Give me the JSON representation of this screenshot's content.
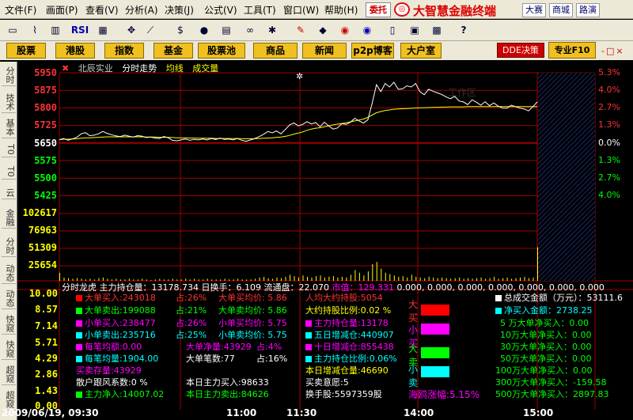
{
  "menu": [
    "文件(F)",
    "画面(P)",
    "查看(V)",
    "分析(A)",
    "决策(J)",
    "公式(V)",
    "工具(T)",
    "窗口(W)",
    "帮助(H)"
  ],
  "entrust_label": "委托",
  "brand_title": "大智慧金融终端",
  "sites": [
    "大赛",
    "商城",
    "路演"
  ],
  "nav_buttons": [
    "股票",
    "港股",
    "指数",
    "基金",
    "股票池",
    "商品",
    "新闻",
    "p2p博客",
    "大户室"
  ],
  "workarea_label": "工作区",
  "dde_label": "DDE决策",
  "pro_label": "专业F10",
  "side_tabs": [
    "分时",
    "技术",
    "基本",
    "T0",
    "T0",
    "云",
    "金融",
    "分时",
    "动态",
    "动态",
    "快窥",
    "快窥",
    "超窥",
    "超窥"
  ],
  "header": {
    "stock": "北辰实业",
    "mode": "分时走势",
    "avg": "均线",
    "vol": "成交量"
  },
  "price_labels": [
    "5950",
    "5875",
    "5800",
    "5725",
    "5650",
    "5575",
    "5500",
    "5425"
  ],
  "pct_up": [
    "5.3%",
    "4.0%",
    "2.7%",
    "1.3%",
    "0.0%"
  ],
  "pct_down": [
    "1.3%",
    "2.7%",
    "4.0%"
  ],
  "vol_labels": [
    "102617",
    "76963",
    "51309",
    "25654"
  ],
  "info_header": {
    "dragon": "分时龙虎",
    "holding": "主力持仓量：13178.734",
    "turnover": "日换手：6.109",
    "float": "流通盘：22.070",
    "mktcap": "市值：129.331",
    "zeros": "0.000, 0.000, 0.000, 0.000, 0.000, 0.000, 0.000"
  },
  "level_labels": [
    "10.00",
    "8.57",
    "7.14",
    "5.71",
    "4.29",
    "2.86",
    "1.43",
    "0.00"
  ],
  "col1": [
    "大单买入:243018",
    "大单卖出:199088",
    "小单买入:238477",
    "小单卖出:235716",
    "每笔均额:0.00",
    "每笔均量:1904.00",
    "买卖存量:43929",
    "散户跟风系数:0 %",
    "主力净入:14007.02"
  ],
  "col2": [
    "占:26%",
    "占:21%",
    "占:26%",
    "占:25%",
    "大单净量:43929",
    "大单笔数:77",
    "本日主力买入:98633",
    "本日主力卖出:84626"
  ],
  "col3": [
    "大单买均价: 5.86",
    "大单卖均价: 5.86",
    "小单买均价: 5.75",
    "小单卖均价: 5.75",
    "占:4%",
    "占:16%"
  ],
  "col4": [
    "人均大约持股:5054",
    "大约持股比例:0.02 %",
    "主力持仓量:13178",
    "五日增减仓:440907",
    "十日增减仓:855438",
    "主力持仓比例:0.06%",
    "本日增减仓量:46690",
    "买卖意愿:5",
    "换手股:5597359股"
  ],
  "vertical_labels": [
    "大",
    "买",
    "小",
    "买",
    "大",
    "卖",
    "小",
    "卖"
  ],
  "swing": "海鸥涨幅:5.15%",
  "right_col": {
    "title": "总成交金额（万元）：53111.6",
    "rows": [
      "净买入金额：2738.25",
      "5 万大单净买入：0.00",
      "10万大单净买入：0.00",
      "30万大单净买入：0.00",
      "50万大单净买入：0.00",
      "100万大单净买入：0.00",
      "300万大单净买入：-159.58",
      "500万大单净买入：2897.83"
    ]
  },
  "times": {
    "start": "2009/06/19, 09:30",
    "t1": "11:00",
    "t2": "11:30",
    "t3": "14:00",
    "t4": "15:00"
  },
  "colors": {
    "up": "#ff3030",
    "down": "#00ff00",
    "grid": "#a00000",
    "price": "#ffffff",
    "avg": "#ffff00",
    "vol": "#ffff00"
  },
  "series": {
    "price": [
      5665,
      5670,
      5662,
      5668,
      5675,
      5690,
      5695,
      5682,
      5684,
      5690,
      5700,
      5692,
      5686,
      5681,
      5678,
      5684,
      5680,
      5676,
      5682,
      5680,
      5674,
      5676,
      5672,
      5670,
      5678,
      5674,
      5662,
      5660,
      5664,
      5668,
      5662,
      5666,
      5664,
      5668,
      5664,
      5670,
      5666,
      5672,
      5666,
      5668,
      5664,
      5670,
      5662,
      5658,
      5664,
      5670,
      5678,
      5688,
      5700,
      5694,
      5702,
      5690,
      5708,
      5728,
      5736,
      5724,
      5730,
      5742,
      5732,
      5738,
      5720,
      5740,
      5724,
      5710,
      5715,
      5733,
      5730,
      5740,
      5756,
      5745,
      5736,
      5750,
      5820,
      5900,
      5870,
      5905,
      5890,
      5910,
      5880,
      5882,
      5895,
      5890,
      5905,
      5870,
      5857,
      5880,
      5872,
      5865,
      5858,
      5848,
      5840,
      5850,
      5830,
      5826,
      5815,
      5835,
      5825,
      5812,
      5827,
      5810,
      5822,
      5808,
      5800,
      5799,
      5812,
      5806,
      5800,
      5796,
      5788,
      5806,
      5826
    ],
    "avg": [
      5665,
      5667,
      5667,
      5668,
      5669,
      5671,
      5673,
      5673,
      5674,
      5675,
      5676,
      5677,
      5677,
      5677,
      5677,
      5677,
      5677,
      5677,
      5677,
      5677,
      5676,
      5676,
      5676,
      5675,
      5675,
      5675,
      5674,
      5673,
      5673,
      5673,
      5672,
      5672,
      5671,
      5671,
      5671,
      5671,
      5670,
      5670,
      5670,
      5670,
      5670,
      5670,
      5669,
      5669,
      5669,
      5669,
      5670,
      5671,
      5672,
      5673,
      5675,
      5676,
      5679,
      5683,
      5689,
      5693,
      5698,
      5705,
      5710,
      5714,
      5716,
      5720,
      5724,
      5728,
      5731,
      5734,
      5737,
      5741,
      5745,
      5749,
      5753,
      5760,
      5770,
      5780,
      5785,
      5790,
      5792,
      5795,
      5796,
      5797,
      5798,
      5799,
      5800,
      5801,
      5801,
      5802,
      5803,
      5803,
      5804,
      5804,
      5805,
      5805,
      5805,
      5805,
      5806,
      5806,
      5806,
      5806,
      5806,
      5806,
      5806,
      5806,
      5806,
      5806,
      5806,
      5806,
      5806,
      5806,
      5806,
      5806,
      5806
    ],
    "vol": [
      0.12,
      0.05,
      0.04,
      0.03,
      0.04,
      0.03,
      0.02,
      0.03,
      0.02,
      0.04,
      0.05,
      0.03,
      0.02,
      0.03,
      0.02,
      0.02,
      0.03,
      0.02,
      0.02,
      0.03,
      0.02,
      0.01,
      0.02,
      0.03,
      0.02,
      0.02,
      0.03,
      0.02,
      0.02,
      0.03,
      0.02,
      0.03,
      0.02,
      0.02,
      0.03,
      0.02,
      0.02,
      0.02,
      0.03,
      0.02,
      0.02,
      0.03,
      0.02,
      0.02,
      0.02,
      0.03,
      0.05,
      0.06,
      0.04,
      0.03,
      0.05,
      0.04,
      0.06,
      0.09,
      0.07,
      0.05,
      0.08,
      0.06,
      0.05,
      0.07,
      0.08,
      0.05,
      0.06,
      0.07,
      0.05,
      0.06,
      0.05,
      0.09,
      0.16,
      0.12,
      0.08,
      0.14,
      0.25,
      0.28,
      0.18,
      0.12,
      0.1,
      0.08,
      0.06,
      0.07,
      0.05,
      0.09,
      0.06,
      0.05,
      0.04,
      0.06,
      0.05,
      0.04,
      0.05,
      0.04,
      0.03,
      0.04,
      0.05,
      0.03,
      0.04,
      0.03,
      0.04,
      0.05,
      0.03,
      0.04,
      0.06,
      0.03,
      0.04,
      0.05,
      0.03,
      0.04,
      0.05,
      0.06,
      0.04,
      0.05,
      0.5
    ]
  }
}
